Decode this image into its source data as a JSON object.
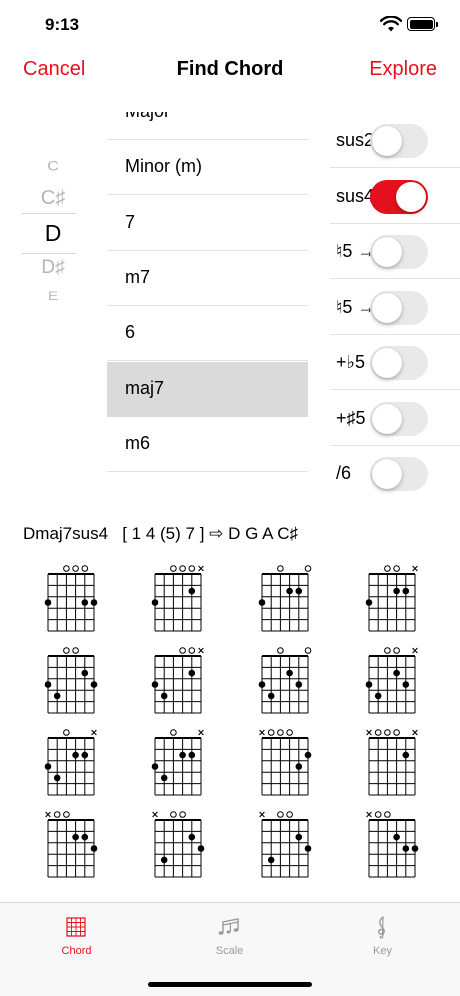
{
  "status": {
    "time": "9:13"
  },
  "nav": {
    "left": "Cancel",
    "title": "Find Chord",
    "right": "Explore"
  },
  "root_picker": {
    "items": [
      "C",
      "C♯",
      "D",
      "D♯",
      "E"
    ],
    "selected": "D"
  },
  "chord_types": {
    "items": [
      "Major",
      "Minor (m)",
      "7",
      "m7",
      "6",
      "maj7",
      "m6"
    ],
    "selected": "maj7"
  },
  "modifiers": [
    {
      "label": "sus2",
      "on": false
    },
    {
      "label": "sus4",
      "on": true
    },
    {
      "label": "♮5 →",
      "on": false
    },
    {
      "label": "♮5 →",
      "on": false
    },
    {
      "label": "+♭5",
      "on": false
    },
    {
      "label": "+♯5",
      "on": false
    },
    {
      "label": "/6",
      "on": false
    }
  ],
  "result": {
    "chord": "Dmaj7sus4",
    "formula": "[ 1 4 (5) 7 ]",
    "arrow": "⇨",
    "notes": "D G A C♯"
  },
  "chord_diagrams": [
    {
      "top": [
        "",
        "",
        "o",
        "o",
        "o",
        ""
      ],
      "dots": [
        [
          0,
          3
        ],
        [
          4,
          3
        ],
        [
          5,
          3
        ]
      ]
    },
    {
      "top": [
        "",
        "",
        "o",
        "o",
        "o",
        "x"
      ],
      "dots": [
        [
          0,
          3
        ],
        [
          4,
          2
        ]
      ]
    },
    {
      "top": [
        "",
        "",
        "o",
        "",
        "",
        "o"
      ],
      "dots": [
        [
          0,
          3
        ],
        [
          3,
          2
        ],
        [
          4,
          2
        ]
      ]
    },
    {
      "top": [
        "",
        "",
        "o",
        "o",
        "",
        "x"
      ],
      "dots": [
        [
          0,
          3
        ],
        [
          3,
          2
        ],
        [
          4,
          2
        ]
      ]
    },
    {
      "top": [
        "",
        "",
        "o",
        "o",
        "",
        ""
      ],
      "dots": [
        [
          0,
          3
        ],
        [
          1,
          4
        ],
        [
          4,
          2
        ],
        [
          5,
          3
        ]
      ]
    },
    {
      "top": [
        "",
        "",
        "",
        "o",
        "o",
        "x"
      ],
      "dots": [
        [
          0,
          3
        ],
        [
          1,
          4
        ],
        [
          4,
          2
        ]
      ]
    },
    {
      "top": [
        "",
        "",
        "o",
        "",
        "",
        "o"
      ],
      "dots": [
        [
          0,
          3
        ],
        [
          1,
          4
        ],
        [
          3,
          2
        ],
        [
          4,
          3
        ]
      ]
    },
    {
      "top": [
        "",
        "",
        "o",
        "o",
        "",
        "x"
      ],
      "dots": [
        [
          0,
          3
        ],
        [
          1,
          4
        ],
        [
          3,
          2
        ],
        [
          4,
          3
        ]
      ]
    },
    {
      "top": [
        "",
        "",
        "o",
        "",
        "",
        "x"
      ],
      "dots": [
        [
          0,
          3
        ],
        [
          1,
          4
        ],
        [
          3,
          2
        ],
        [
          4,
          2
        ]
      ]
    },
    {
      "top": [
        "",
        "",
        "o",
        "",
        "",
        "x"
      ],
      "dots": [
        [
          0,
          3
        ],
        [
          1,
          4
        ],
        [
          3,
          2
        ],
        [
          4,
          2
        ]
      ]
    },
    {
      "top": [
        "x",
        "o",
        "o",
        "o",
        "",
        ""
      ],
      "dots": [
        [
          4,
          3
        ],
        [
          5,
          2
        ]
      ]
    },
    {
      "top": [
        "x",
        "o",
        "o",
        "o",
        "",
        "x"
      ],
      "dots": [
        [
          4,
          2
        ]
      ]
    },
    {
      "top": [
        "x",
        "o",
        "o",
        "",
        "",
        ""
      ],
      "dots": [
        [
          3,
          2
        ],
        [
          4,
          2
        ],
        [
          5,
          3
        ]
      ]
    },
    {
      "top": [
        "x",
        "",
        "o",
        "o",
        "",
        ""
      ],
      "dots": [
        [
          1,
          4
        ],
        [
          4,
          2
        ],
        [
          5,
          3
        ]
      ]
    },
    {
      "top": [
        "x",
        "",
        "o",
        "o",
        "",
        ""
      ],
      "dots": [
        [
          1,
          4
        ],
        [
          4,
          2
        ],
        [
          5,
          3
        ]
      ]
    },
    {
      "top": [
        "x",
        "o",
        "o",
        "",
        "",
        ""
      ],
      "dots": [
        [
          3,
          2
        ],
        [
          4,
          3
        ],
        [
          5,
          3
        ]
      ]
    }
  ],
  "tabs": [
    {
      "label": "Chord",
      "icon": "chord-grid-icon",
      "active": true
    },
    {
      "label": "Scale",
      "icon": "music-notes-icon",
      "active": false
    },
    {
      "label": "Key",
      "icon": "treble-clef-icon",
      "active": false
    }
  ],
  "colors": {
    "accent": "#e5101f",
    "selected_row": "#dadada",
    "toggle_off": "#e9e9ea"
  }
}
